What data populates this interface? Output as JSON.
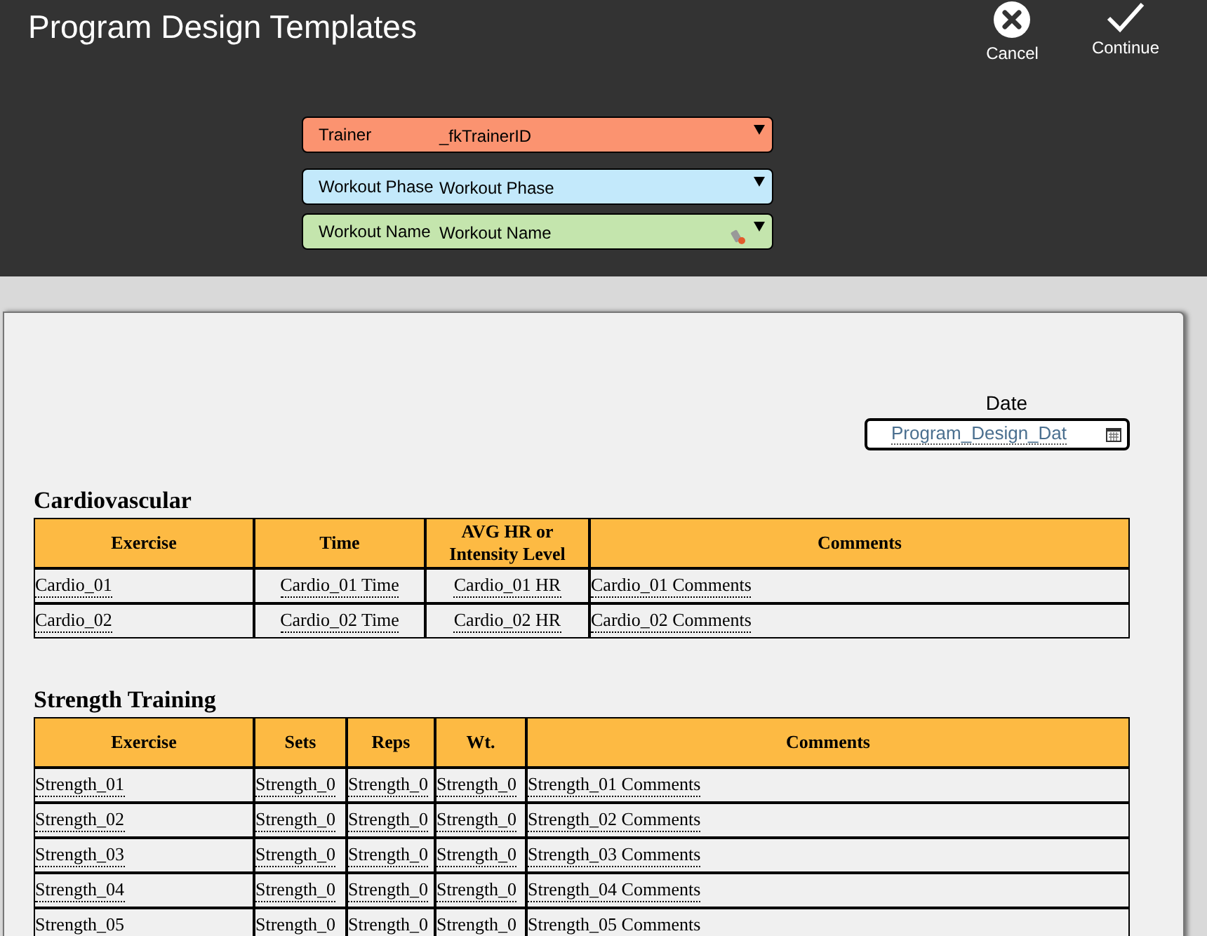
{
  "window": {
    "title": "Program Design Templates"
  },
  "actions": [
    {
      "kind": "cancel",
      "label": "Cancel"
    },
    {
      "kind": "continue",
      "label": "Continue"
    }
  ],
  "filters": [
    {
      "label": "Trainer",
      "value": "_fkTrainerID",
      "color": "#fb9370",
      "edit_icon": false
    },
    {
      "label": "Workout Phase",
      "value": "Workout Phase",
      "color": "#c3e9fb",
      "edit_icon": false
    },
    {
      "label": "Workout Name",
      "value": "Workout Name",
      "color": "#c4e5ad",
      "edit_icon": true
    }
  ],
  "date": {
    "label": "Date",
    "value": "Program_Design_Dat"
  },
  "cardio": {
    "title": "Cardiovascular",
    "columns": [
      "Exercise",
      "Time",
      "AVG HR or Intensity Level",
      "Comments"
    ],
    "rows": [
      [
        "Cardio_01",
        "Cardio_01 Time",
        "Cardio_01 HR",
        "Cardio_01 Comments"
      ],
      [
        "Cardio_02",
        "Cardio_02 Time",
        "Cardio_02 HR",
        "Cardio_02 Comments"
      ]
    ]
  },
  "strength": {
    "title": "Strength Training",
    "columns": [
      "Exercise",
      "Sets",
      "Reps",
      "Wt.",
      "Comments"
    ],
    "rows": [
      [
        "Strength_01",
        "Strength_0",
        "Strength_0",
        "Strength_0",
        "Strength_01 Comments"
      ],
      [
        "Strength_02",
        "Strength_0",
        "Strength_0",
        "Strength_0",
        "Strength_02 Comments"
      ],
      [
        "Strength_03",
        "Strength_0",
        "Strength_0",
        "Strength_0",
        "Strength_03 Comments"
      ],
      [
        "Strength_04",
        "Strength_0",
        "Strength_0",
        "Strength_0",
        "Strength_04 Comments"
      ],
      [
        "Strength_05",
        "Strength_0",
        "Strength_0",
        "Strength_0",
        "Strength_05 Comments"
      ]
    ]
  }
}
